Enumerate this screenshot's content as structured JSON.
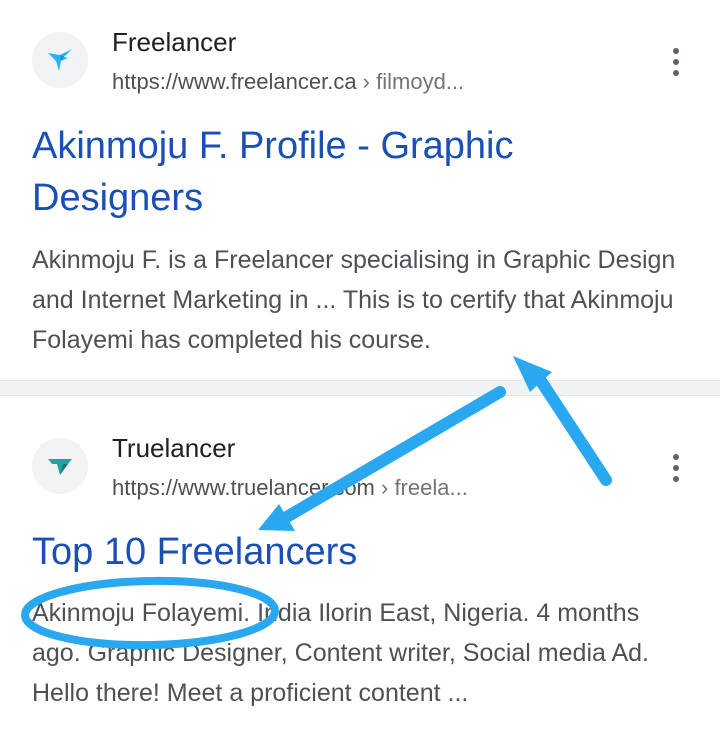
{
  "results": [
    {
      "site_name": "Freelancer",
      "url_base": "https://www.freelancer.ca",
      "url_path": " › filmoyd...",
      "title": "Akinmoju F. Profile - Graphic Designers",
      "snippet": "Akinmoju F. is a Freelancer specialising in Graphic Design and Internet Marketing in ... This is to certify that Akinmoju Folayemi has completed his course.",
      "favicon": "freelancer-bird-icon"
    },
    {
      "site_name": "Truelancer",
      "url_base": "https://www.truelancer.com",
      "url_path": " › freela...",
      "title": "Top 10 Freelancers",
      "snippet": "Akinmoju Folayemi. India Ilorin East, Nigeria. 4 months ago. Graphic Designer, Content writer, Social media Ad. Hello there! Meet a proficient content ...",
      "favicon": "truelancer-icon"
    }
  ],
  "colors": {
    "link_title": "#1a4fb5",
    "annotation": "#29a8ef",
    "snippet_text": "#4d5156"
  },
  "icons": [
    "freelancer-bird-icon",
    "truelancer-icon",
    "more-vert-icon"
  ]
}
